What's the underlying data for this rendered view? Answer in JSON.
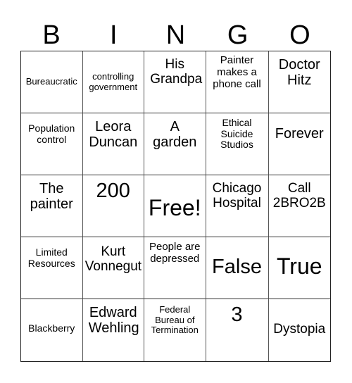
{
  "header": [
    "B",
    "I",
    "N",
    "G",
    "O"
  ],
  "cells": [
    [
      "Bureaucratic",
      "controlling government",
      "His Grandpa",
      "Painter makes a phone call",
      "Doctor Hitz"
    ],
    [
      "Population control",
      "Leora Duncan",
      "A garden",
      "Ethical Suicide Studios",
      "Forever"
    ],
    [
      "The painter",
      "200",
      "Free!",
      "Chicago Hospital",
      "Call 2BRO2B"
    ],
    [
      "Limited Resources",
      "Kurt Vonnegut",
      "People are depressed",
      "False",
      "True"
    ],
    [
      "Blackberry",
      "Edward Wehling",
      "Federal Bureau of Termination",
      "3",
      "Dystopia"
    ]
  ]
}
